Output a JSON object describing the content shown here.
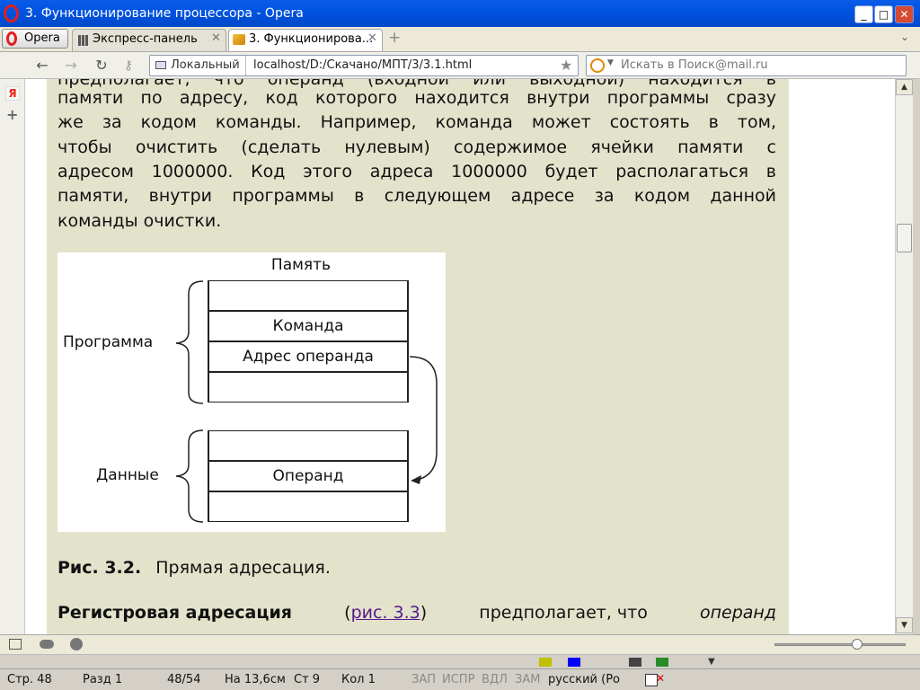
{
  "window": {
    "title": "3. Функционирование процессора - Opera",
    "controls": [
      "_",
      "□",
      "✕"
    ]
  },
  "tabs": {
    "menu_label": "Opera",
    "items": [
      {
        "label": "Экспресс-панель"
      },
      {
        "label": "3. Функционирова..."
      }
    ]
  },
  "address": {
    "site_label": "Локальный",
    "url": "localhost/D:/Скачано/МПТ/3/3.1.html",
    "search_placeholder": "Искать в Поиск@mail.ru"
  },
  "side_panel": {
    "icons": [
      "yandex-icon",
      "add-icon"
    ],
    "yandex_letter": "Я",
    "add_glyph": "+"
  },
  "content": {
    "paragraph_lines": [
      "предполагает, что операнд (входной или выходной) находится в",
      "памяти по адресу, код которого находится внутри программы сразу",
      "же за кодом команды. Например, команда может состоять в том,",
      "чтобы очистить (сделать нулевым) содержимое ячейки памяти с",
      "адресом 1000000. Код этого адреса 1000000 будет располагаться в",
      "памяти, внутри программы в следующем адресе за кодом данной",
      "команды очистки."
    ],
    "figure": {
      "title": "Память",
      "program_label": "Программа",
      "data_label": "Данные",
      "program_cells": [
        "",
        "Команда",
        "Адрес операнда",
        ""
      ],
      "data_cells": [
        "",
        "Операнд",
        ""
      ]
    },
    "caption_num": "Рис. 3.2.",
    "caption_text": "Прямая адресация.",
    "next_bold": "Регистровая адресация",
    "next_paren_open": "(",
    "next_link": "рис. 3.3",
    "next_paren_close": ")",
    "next_rest": "предполагает, что",
    "next_italic": "операнд"
  },
  "status": {
    "zoom_slider_value": 0.62
  },
  "word_status": {
    "page": "Стр. 48",
    "section": "Разд 1",
    "pages": "48/54",
    "position": "На 13,6см",
    "line": "Ст 9",
    "col": "Кол 1",
    "rec": "ЗАП",
    "trk": "ИСПР",
    "ext": "ВДЛ",
    "ovr": "ЗАМ",
    "lang": "русский (Ро"
  },
  "colors": {
    "title_bar": "#0054e3",
    "page_background": "#e3e3cc",
    "link": "#551a8b"
  }
}
